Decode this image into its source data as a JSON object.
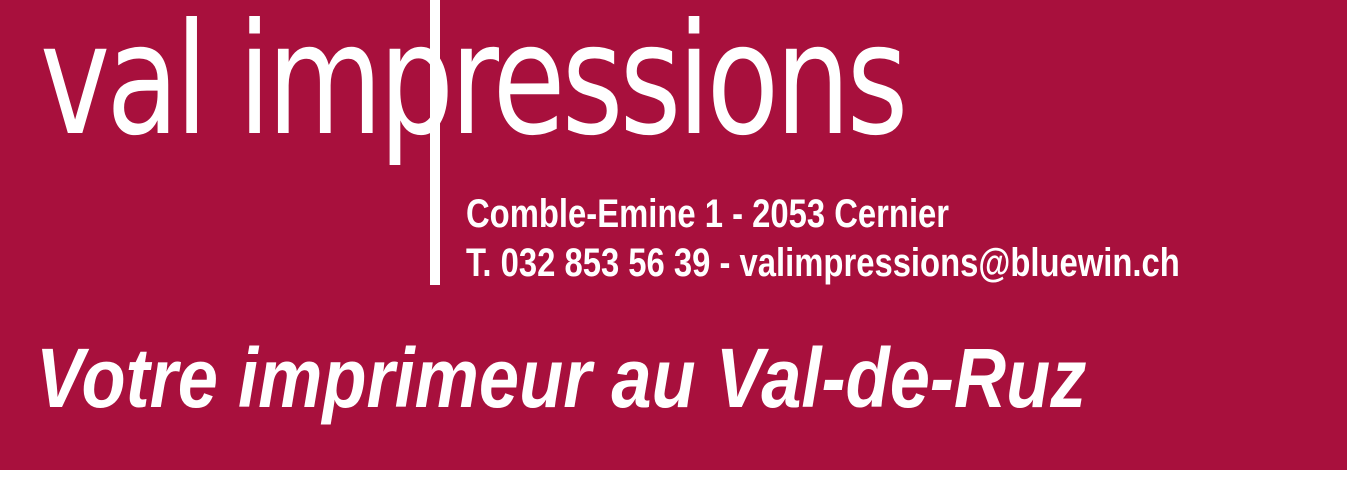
{
  "brand": {
    "name": "val impressions"
  },
  "contact": {
    "address": "Comble-Emine 1 - 2053 Cernier",
    "phone_email": "T. 032 853 56 39 - valimpressions@bluewin.ch"
  },
  "tagline": "Votre imprimeur au Val-de-Ruz",
  "colors": {
    "background": "#a8103d",
    "text": "#ffffff",
    "page": "#ffffff"
  }
}
